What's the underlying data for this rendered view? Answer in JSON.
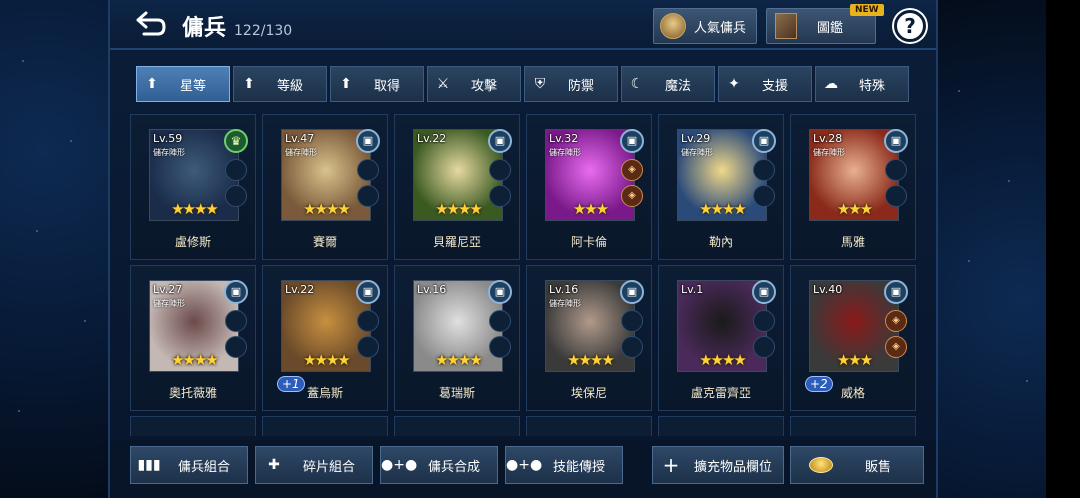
{
  "header": {
    "title": "傭兵",
    "count": "122/130",
    "popular_label": "人氣傭兵",
    "codex_label": "圖鑑",
    "new_badge": "NEW",
    "help_label": "?"
  },
  "tabs": [
    {
      "label": "星等",
      "icon": "arrow-up-icon",
      "active": true
    },
    {
      "label": "等級",
      "icon": "arrow-up-icon"
    },
    {
      "label": "取得",
      "icon": "arrow-up-icon"
    },
    {
      "label": "攻擊",
      "icon": "sword-icon"
    },
    {
      "label": "防禦",
      "icon": "shield-icon"
    },
    {
      "label": "魔法",
      "icon": "magic-icon"
    },
    {
      "label": "支援",
      "icon": "support-icon"
    },
    {
      "label": "特殊",
      "icon": "special-icon"
    }
  ],
  "cards": [
    {
      "level": "Lv.59",
      "storage": "儲存陣形",
      "name": "盧修斯",
      "stars": 4,
      "badge": "crown",
      "colors": [
        "#1a2c4a",
        "#3e5b7a"
      ]
    },
    {
      "level": "Lv.47",
      "storage": "儲存陣形",
      "name": "賽爾",
      "stars": 4,
      "badge": "lock",
      "colors": [
        "#7a5a3a",
        "#d9c28c"
      ]
    },
    {
      "level": "Lv.22",
      "storage": "",
      "name": "貝羅尼亞",
      "stars": 4,
      "badge": "lock",
      "colors": [
        "#3a5a22",
        "#e6d9a0"
      ]
    },
    {
      "level": "Lv.32",
      "storage": "儲存陣形",
      "name": "阿卡倫",
      "stars": 3,
      "badge": "lock",
      "equip": true,
      "colors": [
        "#7a1a8a",
        "#e86cf0"
      ]
    },
    {
      "level": "Lv.29",
      "storage": "儲存陣形",
      "name": "勒內",
      "stars": 4,
      "badge": "lock",
      "colors": [
        "#2a4a7a",
        "#f0d88a"
      ]
    },
    {
      "level": "Lv.28",
      "storage": "儲存陣形",
      "name": "馬雅",
      "stars": 3,
      "badge": "lock",
      "colors": [
        "#8a2a1a",
        "#e8b090"
      ]
    },
    {
      "level": "Lv.27",
      "storage": "儲存陣形",
      "name": "奧托薇雅",
      "stars": 4,
      "badge": "lock",
      "colors": [
        "#c4b8b4",
        "#6a4a4a"
      ]
    },
    {
      "level": "Lv.22",
      "storage": "",
      "name": "蓋烏斯",
      "stars": 4,
      "badge": "lock",
      "plus": "+1",
      "colors": [
        "#6a4a2a",
        "#c89040"
      ]
    },
    {
      "level": "Lv.16",
      "storage": "",
      "name": "葛瑞斯",
      "stars": 4,
      "badge": "lock",
      "colors": [
        "#8a8a8a",
        "#e0e0e0"
      ]
    },
    {
      "level": "Lv.16",
      "storage": "儲存陣形",
      "name": "埃保尼",
      "stars": 4,
      "badge": "lock",
      "colors": [
        "#3a3a3a",
        "#b09a8a"
      ]
    },
    {
      "level": "Lv.1",
      "storage": "",
      "name": "盧克雷齊亞",
      "stars": 4,
      "badge": "lock",
      "colors": [
        "#4a2a5a",
        "#1a1a1a"
      ]
    },
    {
      "level": "Lv.40",
      "storage": "",
      "name": "威格",
      "stars": 3,
      "badge": "lock",
      "equip": true,
      "plus": "+2",
      "colors": [
        "#3a3a3a",
        "#8a1a1a"
      ]
    }
  ],
  "bottom": {
    "merc_combine": "傭兵組合",
    "fragment_combine": "碎片組合",
    "merc_synthesis": "傭兵合成",
    "skill_transfer": "技能傳授",
    "expand_slots": "擴充物品欄位",
    "sell": "販售"
  }
}
